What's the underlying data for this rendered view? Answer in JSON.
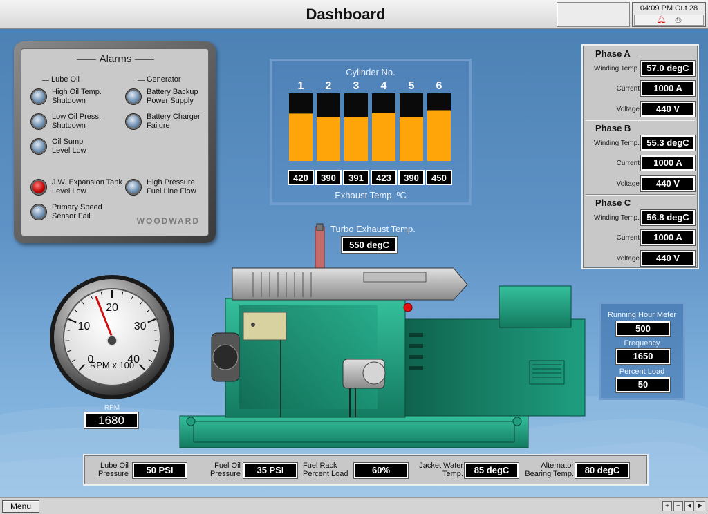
{
  "header": {
    "title": "Dashboard",
    "clock": "04:09 PM Out 28",
    "icons": [
      "bell-icon",
      "printer-icon"
    ]
  },
  "alarms": {
    "title": "Alarms",
    "brand": "WOODWARD",
    "groups": {
      "lube_oil": "Lube Oil",
      "generator": "Generator"
    },
    "items": [
      {
        "label": "High Oil Temp.\nShutdown",
        "active": false
      },
      {
        "label": "Low Oil Press.\nShutdown",
        "active": false
      },
      {
        "label": "Oil Sump\nLevel Low",
        "active": false
      },
      {
        "label": "J.W. Expansion Tank\nLevel Low",
        "active": true
      },
      {
        "label": "Primary Speed\nSensor Fail",
        "active": false
      },
      {
        "label": "Battery Backup\nPower Supply",
        "active": false
      },
      {
        "label": "Battery Charger\nFailure",
        "active": false
      },
      {
        "label": "High Pressure\nFuel Line Flow",
        "active": false
      }
    ]
  },
  "cylinders": {
    "title": "Cylinder No.",
    "footer": "Exhaust Temp. ºC"
  },
  "chart_data": {
    "type": "bar",
    "categories": [
      "1",
      "2",
      "3",
      "4",
      "5",
      "6"
    ],
    "values": [
      420,
      390,
      391,
      423,
      390,
      450
    ],
    "title": "Cylinder No.",
    "xlabel": "Exhaust Temp. ºC",
    "ylim": [
      0,
      600
    ],
    "colors": {
      "fill": "#ffa50a",
      "empty": "#0a0a0a"
    }
  },
  "phases": [
    {
      "title": "Phase  A",
      "winding_label": "Winding Temp.",
      "winding": "57.0 degC",
      "current_label": "Current",
      "current": "1000 A",
      "voltage_label": "Voltage",
      "voltage": "440 V"
    },
    {
      "title": "Phase  B",
      "winding_label": "Winding Temp.",
      "winding": "55.3 degC",
      "current_label": "Current",
      "current": "1000 A",
      "voltage_label": "Voltage",
      "voltage": "440 V"
    },
    {
      "title": "Phase  C",
      "winding_label": "Winding Temp.",
      "winding": "56.8 degC",
      "current_label": "Current",
      "current": "1000 A",
      "voltage_label": "Voltage",
      "voltage": "440 V"
    }
  ],
  "running": {
    "hour_label": "Running Hour Meter",
    "hours": "500",
    "freq_label": "Frequency",
    "freq": "1650",
    "load_label": "Percent Load",
    "load": "50"
  },
  "gauge": {
    "ticks": [
      "0",
      "10",
      "20",
      "30",
      "40"
    ],
    "caption": "RPM x 100",
    "rpm_label": "RPM",
    "rpm": "1680",
    "rpm_value": 16.8,
    "max": 40
  },
  "turbo": {
    "label": "Turbo Exhaust Temp.",
    "value": "550 degC"
  },
  "readouts": [
    {
      "label": "Lube Oil\nPressure",
      "value": "50 PSI"
    },
    {
      "label": "Fuel Oil\nPressure",
      "value": "35 PSI"
    },
    {
      "label": "Fuel Rack\nPercent Load",
      "value": "60%"
    },
    {
      "label": "Jacket Water\nTemp.",
      "value": "85 degC"
    },
    {
      "label": "Alternator\nBearing Temp.",
      "value": "80 degC"
    }
  ],
  "footer": {
    "menu": "Menu",
    "nav": [
      "+",
      "−",
      "◄",
      "►"
    ]
  },
  "colors": {
    "accent_red": "#d01010",
    "engine_green": "#1f9f80",
    "background_blue": "#5f93c6"
  }
}
